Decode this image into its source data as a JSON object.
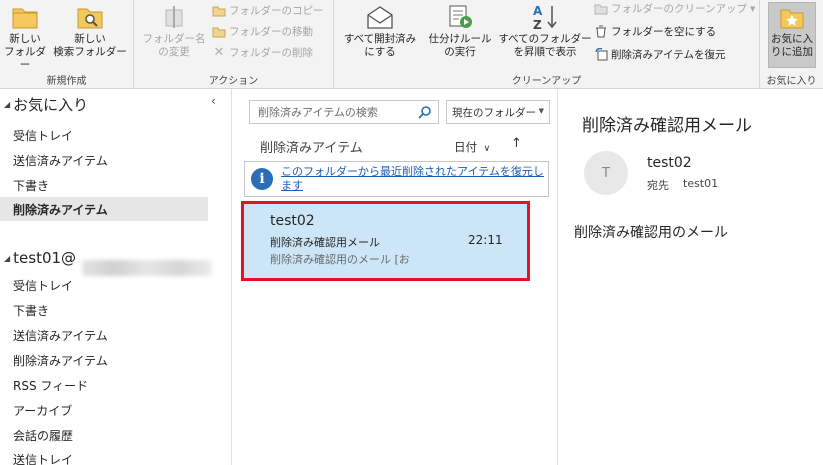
{
  "ribbon": {
    "groups": {
      "new": "新規作成",
      "actions": "アクション",
      "cleanup": "クリーンアップ",
      "favorites": "お気に入り"
    },
    "new_folder": "新しい\nフォルダー",
    "new_search_folder": "新しい\n検索フォルダー",
    "rename_folder": "フォルダー名\nの変更",
    "copy_folder": "フォルダーのコピー",
    "move_folder": "フォルダーの移動",
    "delete_folder": "フォルダーの削除",
    "mark_all_read": "すべて開封済み\nにする",
    "run_rules": "仕分けルール\nの実行",
    "show_ascending": "すべてのフォルダー\nを昇順で表示",
    "clean_folder": "フォルダーのクリーンアップ",
    "empty_folder": "フォルダーを空にする",
    "restore_deleted": "削除済みアイテムを復元",
    "add_favorite": "お気に入\nりに追加"
  },
  "folder_pane": {
    "favorites_header": "お気に入り",
    "favorites": [
      "受信トレイ",
      "送信済みアイテム",
      "下書き",
      "削除済みアイテム"
    ],
    "account_header": "test01@",
    "account_folders": [
      "受信トレイ",
      "下書き",
      "送信済みアイテム",
      "削除済みアイテム",
      "RSS フィード",
      "アーカイブ",
      "会話の履歴",
      "送信トレイ"
    ]
  },
  "message_list": {
    "search_placeholder": "削除済みアイテムの検索",
    "scope": "現在のフォルダー",
    "title": "削除済みアイテム",
    "sort_label": "日付",
    "info_text": "このフォルダーから最近削除されたアイテムを復元します",
    "messages": [
      {
        "sender": "test02",
        "subject": "削除済み確認用メール",
        "time": "22:11",
        "preview": "削除済み確認用のメール [お"
      }
    ]
  },
  "reading_pane": {
    "subject": "削除済み確認用メール",
    "avatar_letter": "T",
    "sender": "test02",
    "to_label": "宛先",
    "to": "test01",
    "body": "削除済み確認用のメール"
  },
  "colors": {
    "selected_message": "#cde6f7",
    "highlight_border": "#e8121d",
    "link": "#1c5cb7",
    "info_icon": "#2a6eb5"
  }
}
